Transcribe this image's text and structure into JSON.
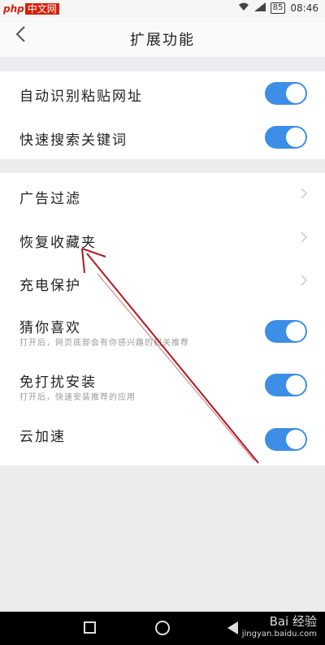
{
  "status_bar": {
    "logo_php": "php",
    "logo_cn": "中文网",
    "battery": "85",
    "time": "08:46"
  },
  "header": {
    "back_icon": "chevron-left-icon",
    "title": "扩展功能"
  },
  "group1": [
    {
      "label": "自动识别粘贴网址",
      "toggle": true
    },
    {
      "label": "快速搜索关键词",
      "toggle": true
    }
  ],
  "group2": [
    {
      "label": "广告过滤",
      "control": "chevron"
    },
    {
      "label": "恢复收藏夹",
      "control": "chevron"
    },
    {
      "label": "充电保护",
      "control": "chevron"
    },
    {
      "label": "猜你喜欢",
      "subtitle": "打开后，网页底部会有你感兴趣的相关推荐",
      "toggle": true
    },
    {
      "label": "免打扰安装",
      "subtitle": "打开后，快速安装推荐的应用",
      "toggle": true
    },
    {
      "label": "云加速",
      "toggle": true
    }
  ],
  "colors": {
    "toggle_on": "#3c8ee6",
    "annotation_arrow": "#b3161d"
  },
  "watermark": {
    "line1": "Bai 经验",
    "line2": "jingyan.baidu.com"
  }
}
